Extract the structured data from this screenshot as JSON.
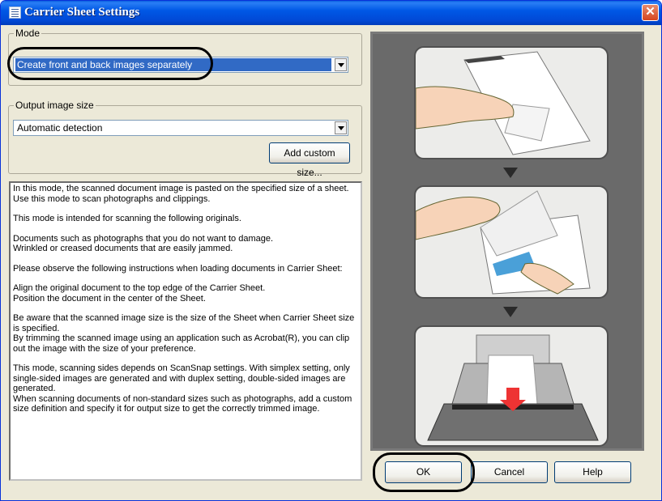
{
  "window": {
    "title": "Carrier Sheet Settings"
  },
  "mode": {
    "label": "Mode",
    "value": "Create front and back images separately"
  },
  "output_size": {
    "label": "Output image size",
    "value": "Automatic detection",
    "add_button": "Add custom size..."
  },
  "description": [
    "In this mode, the scanned document image is pasted on the specified size of a sheet.\nUse this mode to scan photographs and clippings.",
    "This mode is intended for scanning the following originals.",
    "Documents such as photographs that you do not want to damage.\n Wrinkled or creased documents that are easily jammed.",
    "Please observe the following instructions when loading documents in Carrier Sheet:",
    "Align the original document to the top edge of the Carrier Sheet.\nPosition the document in the center of the Sheet.",
    "Be aware that the scanned image size is the size of the Sheet when Carrier Sheet size is specified.\nBy trimming the scanned image using an application such as Acrobat(R), you can clip out the image with the size of your preference.",
    "This mode, scanning sides depends on ScanSnap settings. With simplex setting, only single-sided images are generated and with duplex setting, double-sided images are generated.\nWhen scanning documents of non-standard sizes such as photographs, add a custom size definition and specify it for output size to get the correctly trimmed image."
  ],
  "buttons": {
    "ok": "OK",
    "cancel": "Cancel",
    "help": "Help"
  },
  "colors": {
    "title_bar": "#0054e3",
    "selection": "#316ac5",
    "dialog_bg": "#ece9d8"
  }
}
